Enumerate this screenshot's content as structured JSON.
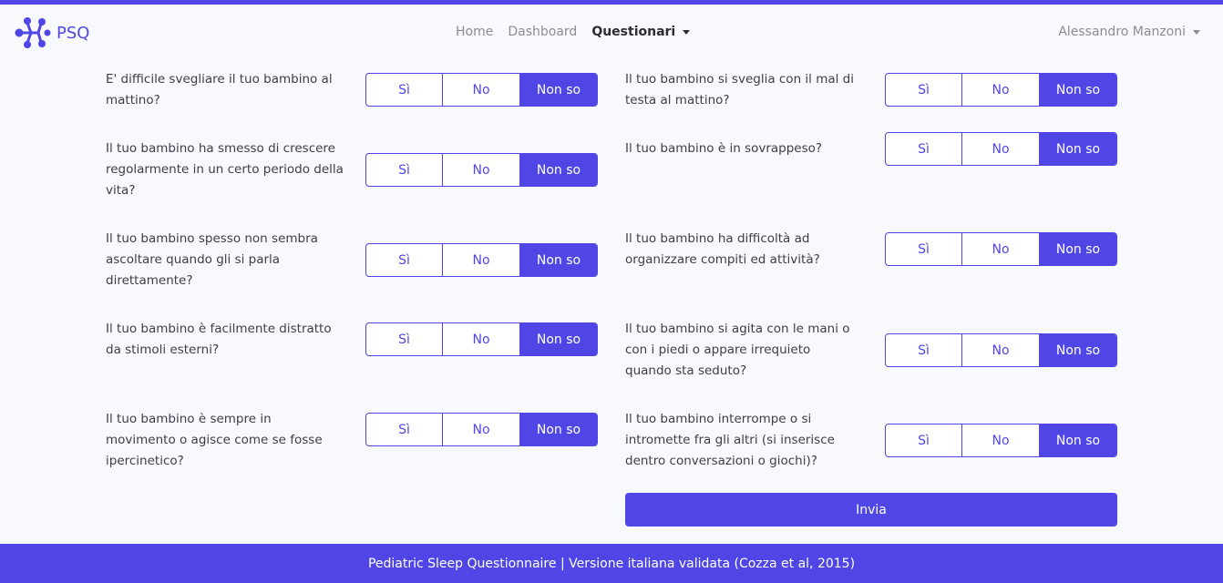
{
  "brand": {
    "name": "PSQ",
    "color": "#5046e5",
    "logo_icon": "molecule-logo-icon"
  },
  "nav": {
    "home": "Home",
    "dashboard": "Dashboard",
    "questionari": "Questionari"
  },
  "user": {
    "name": "Alessandro Manzoni"
  },
  "options": {
    "yes": "Sì",
    "no": "No",
    "unknown": "Non so"
  },
  "questions": [
    {
      "text": "E' difficile svegliare il tuo bambino al mattino?",
      "selected": "Non so"
    },
    {
      "text": "Il tuo bambino si sveglia con il mal di testa al mattino?",
      "selected": "Non so"
    },
    {
      "text": "Il tuo bambino ha smesso di crescere regolarmente in un certo periodo della vita?",
      "selected": "Non so"
    },
    {
      "text": "Il tuo bambino è in sovrappeso?",
      "selected": "Non so"
    },
    {
      "text": "Il tuo bambino spesso non sembra ascoltare quando gli si parla direttamente?",
      "selected": "Non so"
    },
    {
      "text": "Il tuo bambino ha difficoltà ad organizzare compiti ed attività?",
      "selected": "Non so"
    },
    {
      "text": "Il tuo bambino è facilmente distratto da stimoli esterni?",
      "selected": "Non so"
    },
    {
      "text": "Il tuo bambino si agita con le mani o con i piedi o appare irrequieto quando sta seduto?",
      "selected": "Non so"
    },
    {
      "text": "Il tuo bambino è sempre in movimento o agisce come se fosse ipercinetico?",
      "selected": "Non so"
    },
    {
      "text": "Il tuo bambino interrompe o si intromette fra gli altri (si inserisce dentro conversazioni o giochi)?",
      "selected": "Non so"
    }
  ],
  "submit_label": "Invia",
  "footer": "Pediatric Sleep Questionnaire | Versione italiana validata (Cozza et al, 2015)"
}
